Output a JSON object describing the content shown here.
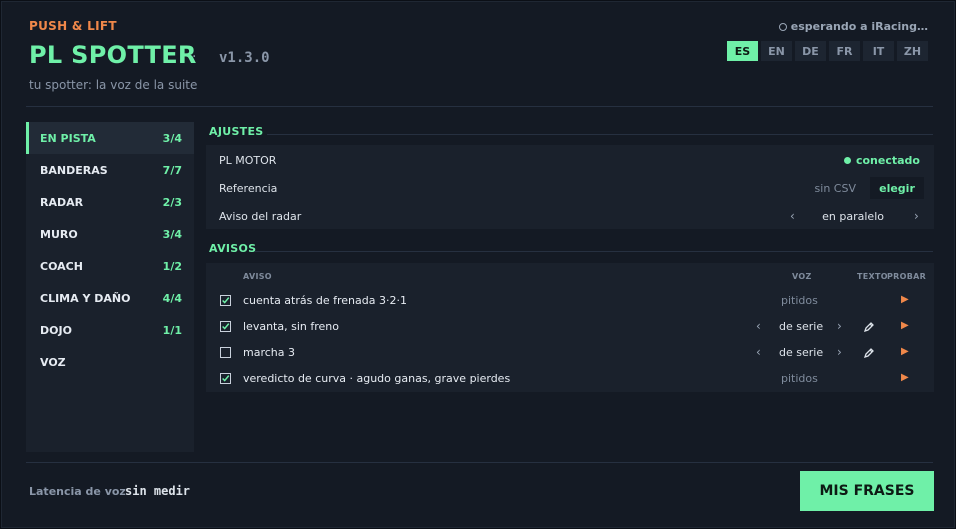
{
  "header": {
    "brand": "PUSH & LIFT",
    "title": "PL SPOTTER",
    "separator": "·",
    "version": "v1.3.0",
    "subtitle": "tu spotter: la voz de la suite",
    "status": "esperando a iRacing…"
  },
  "languages": [
    {
      "code": "ES",
      "active": true
    },
    {
      "code": "EN",
      "active": false
    },
    {
      "code": "DE",
      "active": false
    },
    {
      "code": "FR",
      "active": false
    },
    {
      "code": "IT",
      "active": false
    },
    {
      "code": "ZH",
      "active": false
    }
  ],
  "sidebar": {
    "items": [
      {
        "label": "EN PISTA",
        "count": "3/4",
        "active": true
      },
      {
        "label": "BANDERAS",
        "count": "7/7",
        "active": false
      },
      {
        "label": "RADAR",
        "count": "2/3",
        "active": false
      },
      {
        "label": "MURO",
        "count": "3/4",
        "active": false
      },
      {
        "label": "COACH",
        "count": "1/2",
        "active": false
      },
      {
        "label": "CLIMA Y DAÑO",
        "count": "4/4",
        "active": false
      },
      {
        "label": "DOJO",
        "count": "1/1",
        "active": false
      },
      {
        "label": "VOZ",
        "count": "",
        "active": false
      }
    ]
  },
  "settings": {
    "title": "AJUSTES",
    "motor_label": "PL MOTOR",
    "motor_status": "conectado",
    "ref_label": "Referencia",
    "ref_value": "sin CSV",
    "ref_button": "elegir",
    "radar_label": "Aviso del radar",
    "radar_value": "en paralelo",
    "prev": "‹",
    "next": "›"
  },
  "alerts": {
    "title": "AVISOS",
    "headers": {
      "aviso": "AVISO",
      "voz": "VOZ",
      "texto": "TEXTO",
      "probar": "PROBAR"
    },
    "rows": [
      {
        "checked": true,
        "label": "cuenta atrás de frenada 3·2·1",
        "voice": "pitidos",
        "selectable": false,
        "editable": false
      },
      {
        "checked": true,
        "label": "levanta, sin freno",
        "voice": "de serie",
        "selectable": true,
        "editable": true
      },
      {
        "checked": false,
        "label": "marcha 3",
        "voice": "de serie",
        "selectable": true,
        "editable": true
      },
      {
        "checked": true,
        "label": "veredicto de curva · agudo ganas, grave pierdes",
        "voice": "pitidos",
        "selectable": false,
        "editable": false
      }
    ],
    "play_symbol": "▶"
  },
  "footer": {
    "latency_label": "Latencia de voz",
    "latency_value": "sin medir",
    "button": "MIS FRASES"
  },
  "colors": {
    "accent": "#6ff0a8",
    "brand": "#f0884a",
    "background": "#141a24",
    "panel": "#1a212c"
  }
}
